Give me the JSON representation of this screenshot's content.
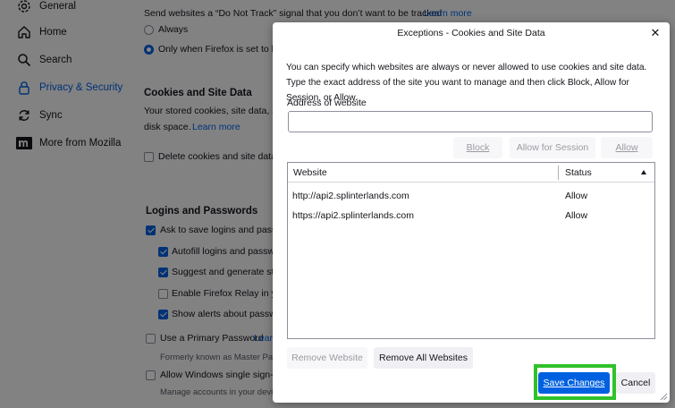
{
  "sidebar": {
    "items": [
      {
        "label": "General",
        "icon": "gear-icon"
      },
      {
        "label": "Home",
        "icon": "home-icon"
      },
      {
        "label": "Search",
        "icon": "search-icon"
      },
      {
        "label": "Privacy & Security",
        "icon": "lock-icon",
        "active": true
      },
      {
        "label": "Sync",
        "icon": "sync-icon"
      },
      {
        "label": "More from Mozilla",
        "icon": "mozilla-icon"
      }
    ]
  },
  "background": {
    "dnt_text": "Send websites a “Do Not Track” signal that you don’t want to be tracked",
    "dnt_link": "Learn more",
    "radio_always": "Always",
    "radio_firefox": "Only when Firefox is set to bloc",
    "cookies_title": "Cookies and Site Data",
    "cookies_desc_1": "Your stored cookies, site data, and",
    "cookies_desc_2": "disk space.",
    "cookies_link": "Learn more",
    "delete_cookies": "Delete cookies and site data w",
    "logins_title": "Logins and Passwords",
    "ask_save": "Ask to save logins and passwo",
    "autofill": "Autofill logins and passwo",
    "suggest": "Suggest and generate stro",
    "relay": "Enable Firefox Relay in you",
    "alerts": "Show alerts about passwor",
    "primary_pw": "Use a Primary Password",
    "primary_link": "Learn",
    "formerly": "Formerly known as Master Passv",
    "windows_sso": "Allow Windows single sign-on",
    "manage_accounts": "Manage accounts in your device"
  },
  "dialog": {
    "title": "Exceptions - Cookies and Site Data",
    "close_glyph": "✕",
    "intro": "You can specify which websites are always or never allowed to use cookies and site data. Type the exact address of the site you want to manage and then click Block, Allow for Session, or Allow.",
    "address_label": "Address of website",
    "address_value": "",
    "block_label": "Block",
    "allow_session_label": "Allow for Session",
    "allow_label": "Allow",
    "columns": {
      "website": "Website",
      "status": "Status"
    },
    "rows": [
      {
        "website": "http://api2.splinterlands.com",
        "status": "Allow"
      },
      {
        "website": "https://api2.splinterlands.com",
        "status": "Allow"
      }
    ],
    "remove_website": "Remove Website",
    "remove_all": "Remove All Websites",
    "save_changes": "Save Changes",
    "cancel": "Cancel"
  },
  "colors": {
    "accent": "#0061e0",
    "highlight": "#2fc22a"
  }
}
